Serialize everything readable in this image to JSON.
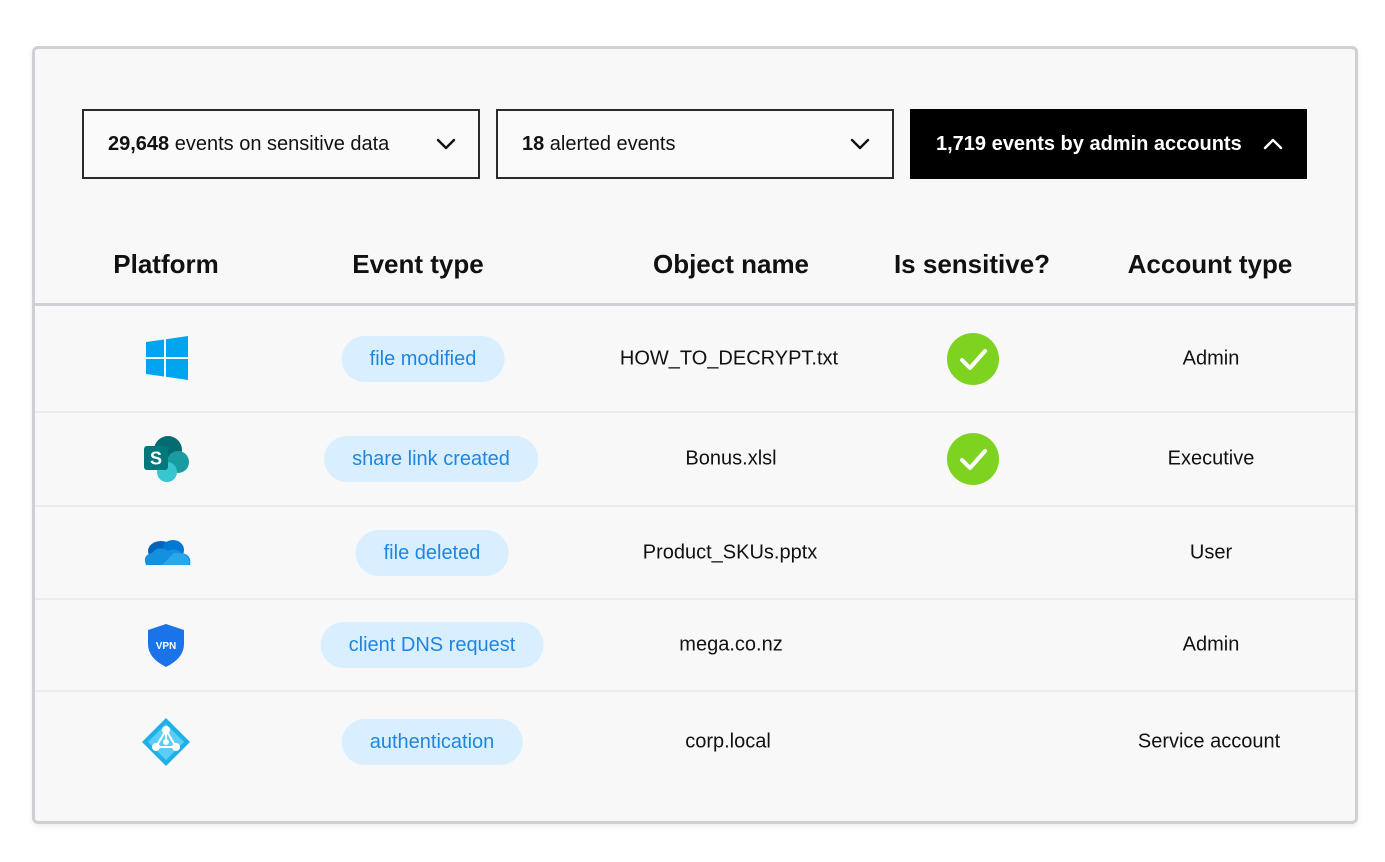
{
  "filters": [
    {
      "count": "29,648",
      "label": " events on sensitive data",
      "state": "collapsed"
    },
    {
      "count": "18",
      "label": " alerted events",
      "state": "collapsed"
    },
    {
      "count": "1,719",
      "label": " events by admin accounts",
      "state": "expanded"
    }
  ],
  "table": {
    "headers": [
      "Platform",
      "Event type",
      "Object name",
      "Is sensitive?",
      "Account type"
    ],
    "rows": [
      {
        "platform_icon": "windows-icon",
        "event_type": "file modified",
        "object_name": "HOW_TO_DECRYPT.txt",
        "is_sensitive": true,
        "account_type": "Admin"
      },
      {
        "platform_icon": "sharepoint-icon",
        "event_type": "share link created",
        "object_name": "Bonus.xlsl",
        "is_sensitive": true,
        "account_type": "Executive"
      },
      {
        "platform_icon": "onedrive-icon",
        "event_type": "file deleted",
        "object_name": "Product_SKUs.pptx",
        "is_sensitive": false,
        "account_type": "User"
      },
      {
        "platform_icon": "vpn-icon",
        "event_type": "client DNS request",
        "object_name": "mega.co.nz",
        "is_sensitive": false,
        "account_type": "Admin"
      },
      {
        "platform_icon": "azure-ad-icon",
        "event_type": "authentication",
        "object_name": "corp.local",
        "is_sensitive": false,
        "account_type": "Service account"
      }
    ]
  },
  "icons": {
    "sharepoint_letter": "S",
    "vpn_text": "VPN"
  },
  "colors": {
    "pill_bg": "#d9efff",
    "pill_text": "#1f86e0",
    "check_green": "#7ed321",
    "dark_filter": "#000000"
  }
}
